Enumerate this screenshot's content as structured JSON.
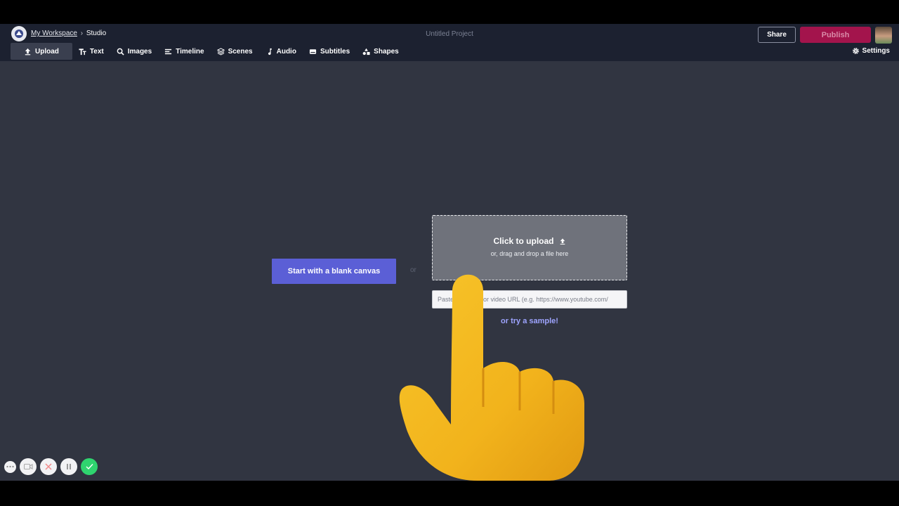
{
  "header": {
    "workspace_link": "My Workspace",
    "separator": "›",
    "section": "Studio",
    "project_title": "Untitled Project",
    "share_label": "Share",
    "publish_label": "Publish",
    "settings_label": "Settings"
  },
  "toolbar": {
    "tabs": [
      {
        "label": "Upload",
        "icon": "upload-icon",
        "active": true
      },
      {
        "label": "Text",
        "icon": "text-icon"
      },
      {
        "label": "Images",
        "icon": "search-icon"
      },
      {
        "label": "Timeline",
        "icon": "timeline-icon"
      },
      {
        "label": "Scenes",
        "icon": "layers-icon"
      },
      {
        "label": "Audio",
        "icon": "music-note-icon"
      },
      {
        "label": "Subtitles",
        "icon": "subtitles-icon"
      },
      {
        "label": "Shapes",
        "icon": "shapes-icon"
      }
    ]
  },
  "main": {
    "blank_canvas_label": "Start with a blank canvas",
    "or_label": "or",
    "upload_title": "Click to upload",
    "upload_subtitle": "or, drag and drop a file here",
    "url_placeholder": "Paste an image or video URL (e.g. https://www.youtube.com/",
    "sample_link": "or try a sample!"
  },
  "colors": {
    "background": "#313541",
    "header": "#1c2130",
    "primary_button": "#5b5fd6",
    "publish": "#a3144c",
    "link": "#9ea4ff",
    "record_done": "#2fd46f"
  }
}
